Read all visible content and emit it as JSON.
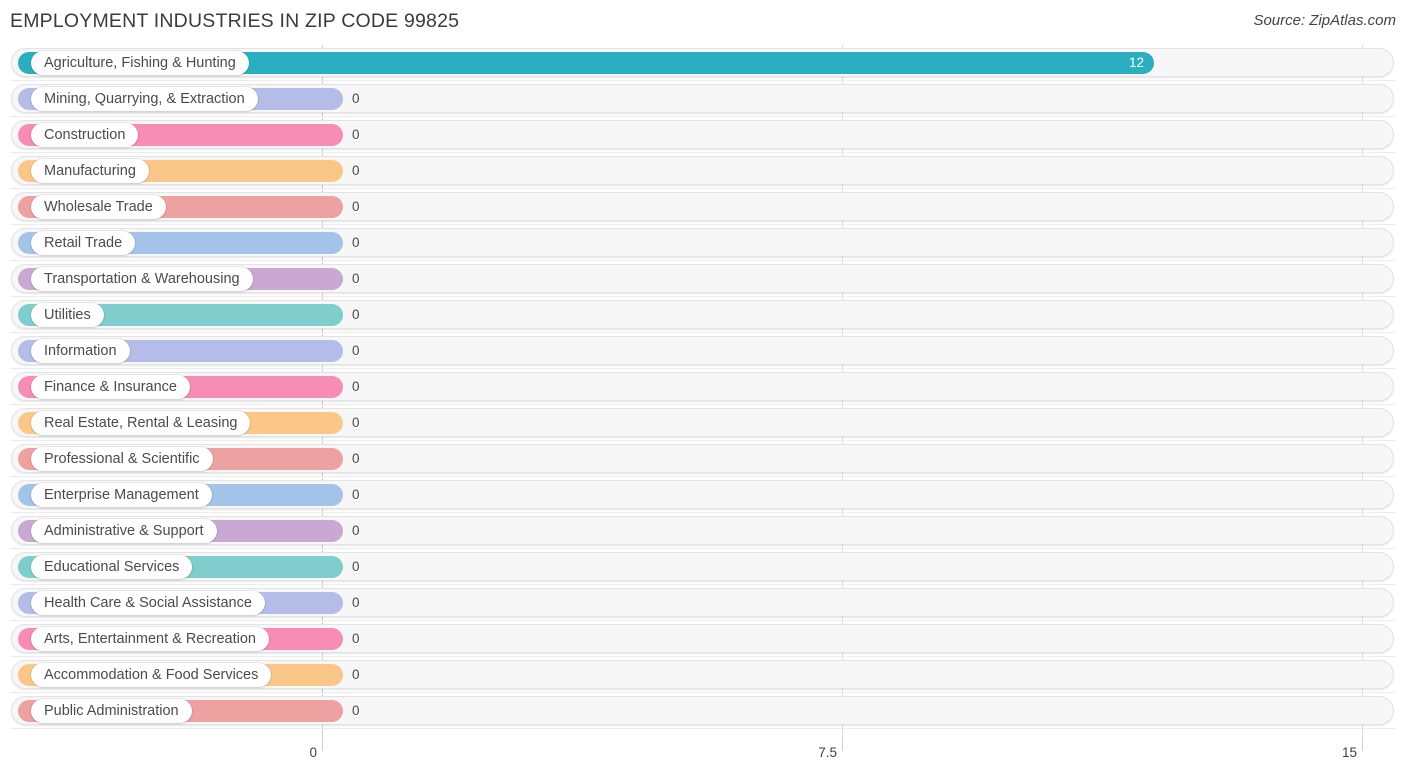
{
  "header": {
    "title": "EMPLOYMENT INDUSTRIES IN ZIP CODE 99825",
    "source": "Source: ZipAtlas.com"
  },
  "chart_data": {
    "type": "bar",
    "orientation": "horizontal",
    "title": "EMPLOYMENT INDUSTRIES IN ZIP CODE 99825",
    "xlabel": "",
    "ylabel": "",
    "xlim": [
      0,
      15
    ],
    "grid": true,
    "legend": "none",
    "axis_ticks": [
      "0",
      "7.5",
      "15"
    ],
    "axis_tick_values": [
      0,
      7.5,
      15
    ],
    "categories": [
      "Agriculture, Fishing & Hunting",
      "Mining, Quarrying, & Extraction",
      "Construction",
      "Manufacturing",
      "Wholesale Trade",
      "Retail Trade",
      "Transportation & Warehousing",
      "Utilities",
      "Information",
      "Finance & Insurance",
      "Real Estate, Rental & Leasing",
      "Professional & Scientific",
      "Enterprise Management",
      "Administrative & Support",
      "Educational Services",
      "Health Care & Social Assistance",
      "Arts, Entertainment & Recreation",
      "Accommodation & Food Services",
      "Public Administration"
    ],
    "values": [
      12,
      0,
      0,
      0,
      0,
      0,
      0,
      0,
      0,
      0,
      0,
      0,
      0,
      0,
      0,
      0,
      0,
      0,
      0
    ],
    "value_labels": [
      "12",
      "0",
      "0",
      "0",
      "0",
      "0",
      "0",
      "0",
      "0",
      "0",
      "0",
      "0",
      "0",
      "0",
      "0",
      "0",
      "0",
      "0",
      "0"
    ],
    "colors": [
      "#2bafc0",
      "#b4bce8",
      "#f78cb4",
      "#fbc788",
      "#eda1a1",
      "#a3c4e8",
      "#c9a8d4",
      "#7fcdcd",
      "#b4bce8",
      "#f78cb4",
      "#fbc788",
      "#eda1a1",
      "#a3c4e8",
      "#c9a8d4",
      "#7fcdcd",
      "#b4bce8",
      "#f78cb4",
      "#fbc788",
      "#eda1a1"
    ]
  }
}
